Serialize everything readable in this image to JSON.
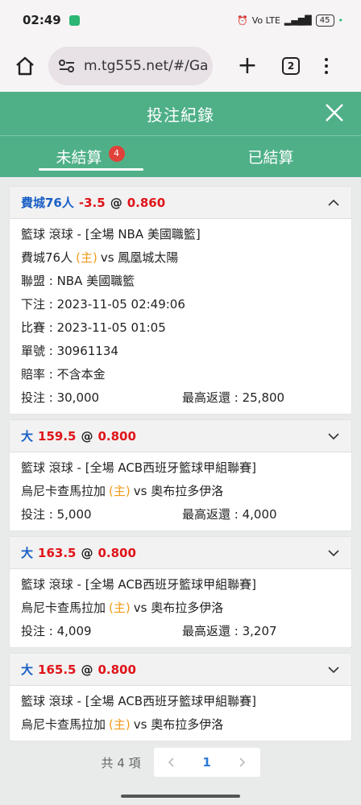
{
  "status": {
    "time": "02:49",
    "battery": "45",
    "net": "Vo LTE"
  },
  "browser": {
    "url": "m.tg555.net/#/Ga",
    "tab_count": "2"
  },
  "header": {
    "title": "投注紀錄"
  },
  "tabs": [
    {
      "label": "未結算",
      "badge": "4"
    },
    {
      "label": "已結算"
    }
  ],
  "bets": [
    {
      "pick": "費城76人",
      "line": "-3.5",
      "at": "@",
      "odds": "0.860",
      "sport_line": "籃球 滾球 - [全場 NBA 美國職籃]",
      "home": "費城76人",
      "home_mark": "(主)",
      "vs": "vs",
      "away": "鳳凰城太陽",
      "league": "聯盟 : NBA 美國職籃",
      "placed": "下注 : 2023-11-05 02:49:06",
      "match": "比賽 : 2023-11-05 01:05",
      "ticket": "單號 : 30961134",
      "odds_type": "賠率 : 不含本金",
      "stake": "投注 : 30,000",
      "max_return": "最高返還 : 25,800"
    },
    {
      "pick": "大",
      "line": "159.5",
      "at": "@",
      "odds": "0.800",
      "sport_line": "籃球 滾球 - [全場 ACB西班牙籃球甲組聯賽]",
      "home": "烏尼卡查馬拉加",
      "home_mark": "(主)",
      "vs": "vs",
      "away": "奧布拉多伊洛",
      "stake": "投注 : 5,000",
      "max_return": "最高返還 : 4,000"
    },
    {
      "pick": "大",
      "line": "163.5",
      "at": "@",
      "odds": "0.800",
      "sport_line": "籃球 滾球 - [全場 ACB西班牙籃球甲組聯賽]",
      "home": "烏尼卡查馬拉加",
      "home_mark": "(主)",
      "vs": "vs",
      "away": "奧布拉多伊洛",
      "stake": "投注 : 4,009",
      "max_return": "最高返還 : 3,207"
    },
    {
      "pick": "大",
      "line": "165.5",
      "at": "@",
      "odds": "0.800",
      "sport_line": "籃球 滾球 - [全場 ACB西班牙籃球甲組聯賽]",
      "home": "烏尼卡查馬拉加",
      "home_mark": "(主)",
      "vs": "vs",
      "away": "奧布拉多伊洛"
    }
  ],
  "pager": {
    "total": "共 4 項",
    "page": "1"
  },
  "colors": {
    "header": "#4fb088",
    "pick": "#1a5fc7",
    "odds": "#e0141a",
    "home_mark": "#f29a1b",
    "badge": "#e0413a"
  },
  "icons": {
    "home": "home-icon",
    "site": "site-settings-icon",
    "close": "close-icon",
    "collapse": "chevron-up-icon",
    "expand": "chevron-down-icon"
  }
}
